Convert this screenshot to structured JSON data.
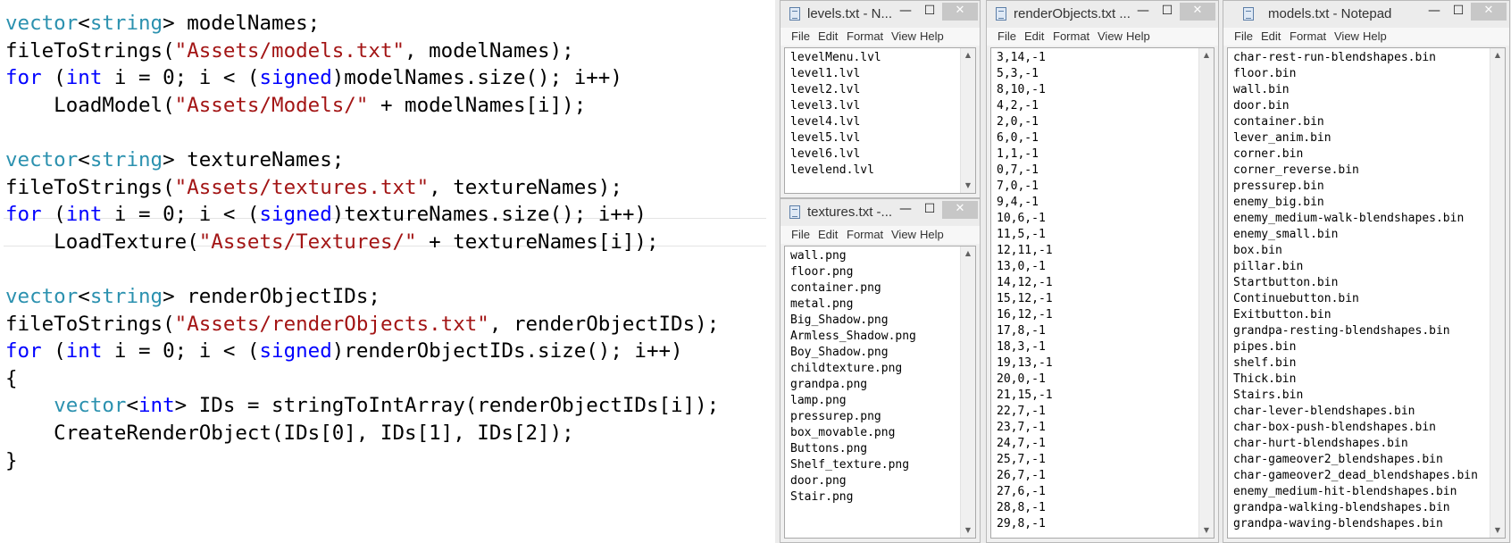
{
  "editor": {
    "lines": [
      [
        {
          "t": "type",
          "v": "vector"
        },
        {
          "t": "plain",
          "v": "<"
        },
        {
          "t": "type",
          "v": "string"
        },
        {
          "t": "plain",
          "v": "> modelNames;"
        }
      ],
      [
        {
          "t": "plain",
          "v": "fileToStrings("
        },
        {
          "t": "str",
          "v": "\"Assets/models.txt\""
        },
        {
          "t": "plain",
          "v": ", modelNames);"
        }
      ],
      [
        {
          "t": "kw",
          "v": "for"
        },
        {
          "t": "plain",
          "v": " ("
        },
        {
          "t": "kw",
          "v": "int"
        },
        {
          "t": "plain",
          "v": " i = 0; i < ("
        },
        {
          "t": "kw",
          "v": "signed"
        },
        {
          "t": "plain",
          "v": ")modelNames.size(); i++)"
        }
      ],
      [
        {
          "t": "plain",
          "v": "    LoadModel("
        },
        {
          "t": "str",
          "v": "\"Assets/Models/\""
        },
        {
          "t": "plain",
          "v": " + modelNames[i]);"
        }
      ],
      [],
      [
        {
          "t": "type",
          "v": "vector"
        },
        {
          "t": "plain",
          "v": "<"
        },
        {
          "t": "type",
          "v": "string"
        },
        {
          "t": "plain",
          "v": "> textureNames;"
        }
      ],
      [
        {
          "t": "plain",
          "v": "fileToStrings("
        },
        {
          "t": "str",
          "v": "\"Assets/textures.txt\""
        },
        {
          "t": "plain",
          "v": ", textureNames);"
        }
      ],
      [
        {
          "t": "kw",
          "v": "for"
        },
        {
          "t": "plain",
          "v": " ("
        },
        {
          "t": "kw",
          "v": "int"
        },
        {
          "t": "plain",
          "v": " i = 0; i < ("
        },
        {
          "t": "kw",
          "v": "signed"
        },
        {
          "t": "plain",
          "v": ")textureNames.size(); i++)"
        }
      ],
      [
        {
          "t": "plain",
          "v": "    LoadTexture("
        },
        {
          "t": "str",
          "v": "\"Assets/Textures/\""
        },
        {
          "t": "plain",
          "v": " + textureNames[i]);"
        }
      ],
      [],
      [
        {
          "t": "type",
          "v": "vector"
        },
        {
          "t": "plain",
          "v": "<"
        },
        {
          "t": "type",
          "v": "string"
        },
        {
          "t": "plain",
          "v": "> renderObjectIDs;"
        }
      ],
      [
        {
          "t": "plain",
          "v": "fileToStrings("
        },
        {
          "t": "str",
          "v": "\"Assets/renderObjects.txt\""
        },
        {
          "t": "plain",
          "v": ", renderObjectIDs);"
        }
      ],
      [
        {
          "t": "kw",
          "v": "for"
        },
        {
          "t": "plain",
          "v": " ("
        },
        {
          "t": "kw",
          "v": "int"
        },
        {
          "t": "plain",
          "v": " i = 0; i < ("
        },
        {
          "t": "kw",
          "v": "signed"
        },
        {
          "t": "plain",
          "v": ")renderObjectIDs.size(); i++)"
        }
      ],
      [
        {
          "t": "plain",
          "v": "{"
        }
      ],
      [
        {
          "t": "plain",
          "v": "    "
        },
        {
          "t": "type",
          "v": "vector"
        },
        {
          "t": "plain",
          "v": "<"
        },
        {
          "t": "kw",
          "v": "int"
        },
        {
          "t": "plain",
          "v": "> IDs = stringToIntArray(renderObjectIDs[i]);"
        }
      ],
      [
        {
          "t": "plain",
          "v": "    CreateRenderObject(IDs[0], IDs[1], IDs[2]);"
        }
      ],
      [
        {
          "t": "plain",
          "v": "}"
        }
      ]
    ]
  },
  "notepad_menu": [
    "File",
    "Edit",
    "Format",
    "View",
    "Help"
  ],
  "window_controls": {
    "minimize": "—",
    "maximize": "☐",
    "close": "✕"
  },
  "windows": [
    {
      "id": "levels",
      "title": "levels.txt - N...",
      "lines": [
        "levelMenu.lvl",
        "level1.lvl",
        "level2.lvl",
        "level3.lvl",
        "level4.lvl",
        "level5.lvl",
        "level6.lvl",
        "levelend.lvl"
      ]
    },
    {
      "id": "textures",
      "title": "textures.txt -...",
      "lines": [
        "wall.png",
        "floor.png",
        "container.png",
        "metal.png",
        "Big_Shadow.png",
        "Armless_Shadow.png",
        "Boy_Shadow.png",
        "childtexture.png",
        "grandpa.png",
        "lamp.png",
        "pressurep.png",
        "box_movable.png",
        "Buttons.png",
        "Shelf_texture.png",
        "door.png",
        "Stair.png"
      ]
    },
    {
      "id": "renderObjects",
      "title": "renderObjects.txt ...",
      "lines": [
        "3,14,-1",
        "5,3,-1",
        "8,10,-1",
        "4,2,-1",
        "2,0,-1",
        "6,0,-1",
        "1,1,-1",
        "0,7,-1",
        "7,0,-1",
        "9,4,-1",
        "10,6,-1",
        "11,5,-1",
        "12,11,-1",
        "13,0,-1",
        "14,12,-1",
        "15,12,-1",
        "16,12,-1",
        "17,8,-1",
        "18,3,-1",
        "19,13,-1",
        "20,0,-1",
        "21,15,-1",
        "22,7,-1",
        "23,7,-1",
        "24,7,-1",
        "25,7,-1",
        "26,7,-1",
        "27,6,-1",
        "28,8,-1",
        "29,8,-1"
      ]
    },
    {
      "id": "models",
      "title": "models.txt - Notepad",
      "lines": [
        "char-rest-run-blendshapes.bin",
        "floor.bin",
        "wall.bin",
        "door.bin",
        "container.bin",
        "lever_anim.bin",
        "corner.bin",
        "corner_reverse.bin",
        "pressurep.bin",
        "enemy_big.bin",
        "enemy_medium-walk-blendshapes.bin",
        "enemy_small.bin",
        "box.bin",
        "pillar.bin",
        "Startbutton.bin",
        "Continuebutton.bin",
        "Exitbutton.bin",
        "grandpa-resting-blendshapes.bin",
        "pipes.bin",
        "shelf.bin",
        "Thick.bin",
        "Stairs.bin",
        "char-lever-blendshapes.bin",
        "char-box-push-blendshapes.bin",
        "char-hurt-blendshapes.bin",
        "char-gameover2_blendshapes.bin",
        "char-gameover2_dead_blendshapes.bin",
        "enemy_medium-hit-blendshapes.bin",
        "grandpa-walking-blendshapes.bin",
        "grandpa-waving-blendshapes.bin"
      ]
    }
  ]
}
